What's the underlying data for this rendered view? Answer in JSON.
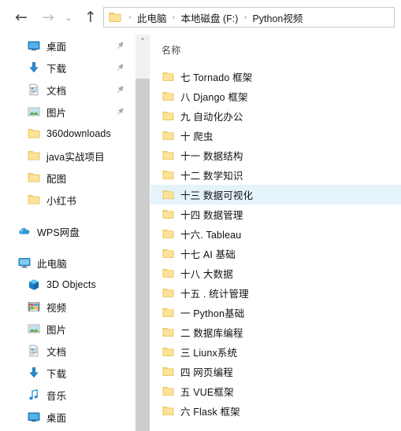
{
  "window": {
    "app": "file-explorer",
    "title": "Python视频"
  },
  "toolbar": {
    "back_label": "←",
    "forward_label": "→",
    "recent_label": "⌄",
    "up_label": "↑",
    "back_name": "back",
    "forward_name": "forward",
    "recent_name": "recent-locations",
    "up_name": "up-one-level"
  },
  "addressbar": {
    "icon": "folder-icon",
    "crumbs": [
      {
        "label": "此电脑"
      },
      {
        "label": "本地磁盘 (F:)"
      },
      {
        "label": "Python视频"
      }
    ],
    "separator": "›"
  },
  "navpane": {
    "scrollbar": {
      "up_arrow": "⌃"
    },
    "groups": [
      {
        "name": "quick-access",
        "items": [
          {
            "label": "桌面",
            "icon": "desktop-icon",
            "pinned": true,
            "level": "child"
          },
          {
            "label": "下载",
            "icon": "download-icon",
            "pinned": true,
            "level": "child"
          },
          {
            "label": "文档",
            "icon": "document-icon",
            "pinned": true,
            "level": "child"
          },
          {
            "label": "图片",
            "icon": "pictures-icon",
            "pinned": true,
            "level": "child"
          },
          {
            "label": "360downloads",
            "icon": "folder-icon",
            "pinned": false,
            "level": "child"
          },
          {
            "label": "java实战项目",
            "icon": "folder-icon",
            "pinned": false,
            "level": "child"
          },
          {
            "label": "配图",
            "icon": "folder-icon",
            "pinned": false,
            "level": "child"
          },
          {
            "label": "小红书",
            "icon": "folder-icon",
            "pinned": false,
            "level": "child"
          }
        ]
      },
      {
        "name": "wps-cloud",
        "items": [
          {
            "label": "WPS网盘",
            "icon": "cloud-icon",
            "pinned": false,
            "level": "root"
          }
        ]
      },
      {
        "name": "this-pc",
        "items": [
          {
            "label": "此电脑",
            "icon": "computer-icon",
            "pinned": false,
            "level": "root"
          },
          {
            "label": "3D Objects",
            "icon": "cube-icon",
            "pinned": false,
            "level": "child"
          },
          {
            "label": "视频",
            "icon": "videos-icon",
            "pinned": false,
            "level": "child"
          },
          {
            "label": "图片",
            "icon": "pictures-icon",
            "pinned": false,
            "level": "child"
          },
          {
            "label": "文档",
            "icon": "document-icon",
            "pinned": false,
            "level": "child"
          },
          {
            "label": "下载",
            "icon": "download-icon",
            "pinned": false,
            "level": "child"
          },
          {
            "label": "音乐",
            "icon": "music-icon",
            "pinned": false,
            "level": "child"
          },
          {
            "label": "桌面",
            "icon": "desktop-icon",
            "pinned": false,
            "level": "child"
          }
        ]
      }
    ]
  },
  "filelist": {
    "columns": [
      "名称"
    ],
    "rows": [
      {
        "name": "七 Tornado 框架",
        "icon": "folder-icon",
        "selected": false
      },
      {
        "name": "八 Django 框架",
        "icon": "folder-icon",
        "selected": false
      },
      {
        "name": "九 自动化办公",
        "icon": "folder-icon",
        "selected": false
      },
      {
        "name": "十 爬虫",
        "icon": "folder-icon",
        "selected": false
      },
      {
        "name": "十一 数据结构",
        "icon": "folder-icon",
        "selected": false
      },
      {
        "name": "十二 数学知识",
        "icon": "folder-icon",
        "selected": false
      },
      {
        "name": "十三 数据可视化",
        "icon": "folder-icon",
        "selected": true
      },
      {
        "name": "十四 数据管理",
        "icon": "folder-icon",
        "selected": false
      },
      {
        "name": "十六. Tableau",
        "icon": "folder-icon",
        "selected": false
      },
      {
        "name": "十七 AI 基础",
        "icon": "folder-icon",
        "selected": false
      },
      {
        "name": "十八 大数据",
        "icon": "folder-icon",
        "selected": false
      },
      {
        "name": "十五 . 统计管理",
        "icon": "folder-icon",
        "selected": false
      },
      {
        "name": "一 Python基础",
        "icon": "folder-icon",
        "selected": false
      },
      {
        "name": "二 数据库编程",
        "icon": "folder-icon",
        "selected": false
      },
      {
        "name": "三 Liunx系统",
        "icon": "folder-icon",
        "selected": false
      },
      {
        "name": "四 网页编程",
        "icon": "folder-icon",
        "selected": false
      },
      {
        "name": "五 VUE框架",
        "icon": "folder-icon",
        "selected": false
      },
      {
        "name": "六 Flask 框架",
        "icon": "folder-icon",
        "selected": false
      }
    ]
  },
  "colors": {
    "selection": "#e5f3fb",
    "folder": "#f8d775",
    "accent_blue": "#1a90d9",
    "scrollbar_thumb": "#cdcdcd",
    "scrollbar_track": "#f0f0f0"
  }
}
